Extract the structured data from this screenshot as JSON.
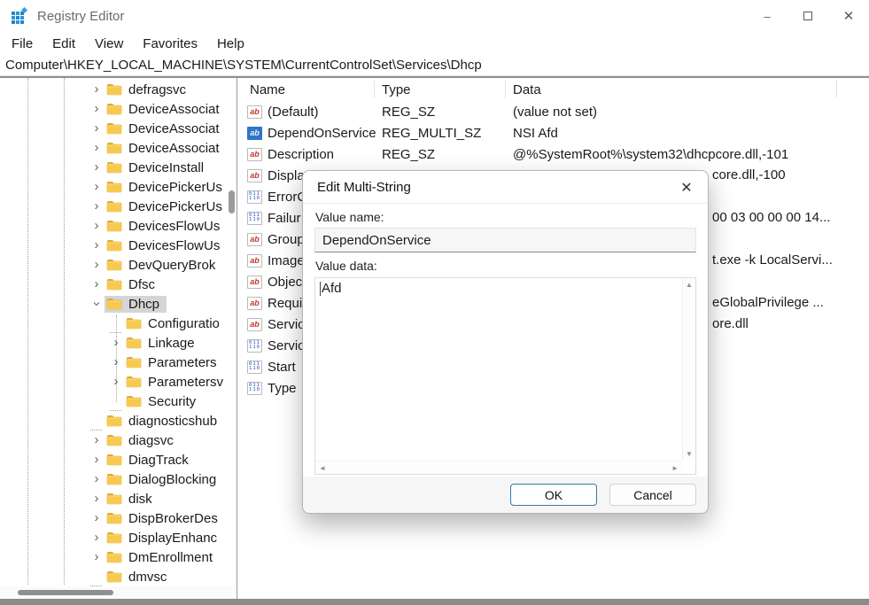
{
  "window": {
    "title": "Registry Editor",
    "controls": {
      "minimize": "–",
      "close": "✕"
    }
  },
  "menu": {
    "items": [
      "File",
      "Edit",
      "View",
      "Favorites",
      "Help"
    ]
  },
  "address": {
    "path": "Computer\\HKEY_LOCAL_MACHINE\\SYSTEM\\CurrentControlSet\\Services\\Dhcp"
  },
  "tree": {
    "items": [
      {
        "label": "defragsvc",
        "level": 0,
        "expander": "collapsed",
        "selected": false
      },
      {
        "label": "DeviceAssociat",
        "level": 0,
        "expander": "collapsed",
        "selected": false
      },
      {
        "label": "DeviceAssociat",
        "level": 0,
        "expander": "collapsed",
        "selected": false
      },
      {
        "label": "DeviceAssociat",
        "level": 0,
        "expander": "collapsed",
        "selected": false
      },
      {
        "label": "DeviceInstall",
        "level": 0,
        "expander": "collapsed",
        "selected": false
      },
      {
        "label": "DevicePickerUs",
        "level": 0,
        "expander": "collapsed",
        "selected": false
      },
      {
        "label": "DevicePickerUs",
        "level": 0,
        "expander": "collapsed",
        "selected": false
      },
      {
        "label": "DevicesFlowUs",
        "level": 0,
        "expander": "collapsed",
        "selected": false
      },
      {
        "label": "DevicesFlowUs",
        "level": 0,
        "expander": "collapsed",
        "selected": false
      },
      {
        "label": "DevQueryBrok",
        "level": 0,
        "expander": "collapsed",
        "selected": false
      },
      {
        "label": "Dfsc",
        "level": 0,
        "expander": "collapsed",
        "selected": false
      },
      {
        "label": "Dhcp",
        "level": 0,
        "expander": "expanded",
        "selected": true
      },
      {
        "label": "Configuratio",
        "level": 1,
        "expander": "none",
        "selected": false
      },
      {
        "label": "Linkage",
        "level": 1,
        "expander": "collapsed",
        "selected": false
      },
      {
        "label": "Parameters",
        "level": 1,
        "expander": "collapsed",
        "selected": false
      },
      {
        "label": "Parametersv",
        "level": 1,
        "expander": "collapsed",
        "selected": false
      },
      {
        "label": "Security",
        "level": 1,
        "expander": "none",
        "selected": false
      },
      {
        "label": "diagnosticshub",
        "level": 0,
        "expander": "none",
        "selected": false
      },
      {
        "label": "diagsvc",
        "level": 0,
        "expander": "collapsed",
        "selected": false
      },
      {
        "label": "DiagTrack",
        "level": 0,
        "expander": "collapsed",
        "selected": false
      },
      {
        "label": "DialogBlocking",
        "level": 0,
        "expander": "collapsed",
        "selected": false
      },
      {
        "label": "disk",
        "level": 0,
        "expander": "collapsed",
        "selected": false
      },
      {
        "label": "DispBrokerDes",
        "level": 0,
        "expander": "collapsed",
        "selected": false
      },
      {
        "label": "DisplayEnhanc",
        "level": 0,
        "expander": "collapsed",
        "selected": false
      },
      {
        "label": "DmEnrollment",
        "level": 0,
        "expander": "collapsed",
        "selected": false
      },
      {
        "label": "dmvsc",
        "level": 0,
        "expander": "none",
        "selected": false
      }
    ]
  },
  "values": {
    "headers": {
      "name": "Name",
      "type": "Type",
      "data": "Data"
    },
    "rows": [
      {
        "icon": "string",
        "selected": false,
        "name": "(Default)",
        "type": "REG_SZ",
        "data": "(value not set)",
        "fragment": ""
      },
      {
        "icon": "string",
        "selected": true,
        "name": "DependOnService",
        "type": "REG_MULTI_SZ",
        "data": "NSI Afd",
        "fragment": ""
      },
      {
        "icon": "string",
        "selected": false,
        "name": "Description",
        "type": "REG_SZ",
        "data": "@%SystemRoot%\\system32\\dhcpcore.dll,-101",
        "fragment": ""
      },
      {
        "icon": "string",
        "selected": false,
        "name": "Displa",
        "type": "",
        "data": "",
        "fragment": "core.dll,-100"
      },
      {
        "icon": "binary",
        "selected": false,
        "name": "ErrorC",
        "type": "",
        "data": "",
        "fragment": ""
      },
      {
        "icon": "binary",
        "selected": false,
        "name": "Failur",
        "type": "",
        "data": "",
        "fragment": "00 03 00 00 00 14..."
      },
      {
        "icon": "string",
        "selected": false,
        "name": "Group",
        "type": "",
        "data": "",
        "fragment": ""
      },
      {
        "icon": "string",
        "selected": false,
        "name": "Image",
        "type": "",
        "data": "",
        "fragment": "t.exe -k LocalServi..."
      },
      {
        "icon": "string",
        "selected": false,
        "name": "Objec",
        "type": "",
        "data": "",
        "fragment": ""
      },
      {
        "icon": "string",
        "selected": false,
        "name": "Requi",
        "type": "",
        "data": "",
        "fragment": "eGlobalPrivilege ..."
      },
      {
        "icon": "string",
        "selected": false,
        "name": "Servic",
        "type": "",
        "data": "",
        "fragment": "ore.dll"
      },
      {
        "icon": "binary",
        "selected": false,
        "name": "Servic",
        "type": "",
        "data": "",
        "fragment": ""
      },
      {
        "icon": "binary",
        "selected": false,
        "name": "Start",
        "type": "",
        "data": "",
        "fragment": ""
      },
      {
        "icon": "binary",
        "selected": false,
        "name": "Type",
        "type": "",
        "data": "",
        "fragment": ""
      }
    ]
  },
  "dialog": {
    "title": "Edit Multi-String",
    "close_glyph": "✕",
    "value_name_label": "Value name:",
    "value_name": "DependOnService",
    "value_data_label": "Value data:",
    "value_data": "Afd",
    "ok_label": "OK",
    "cancel_label": "Cancel"
  },
  "icons": {
    "string_icon_glyph": "ab",
    "binary_icon_line1": "011",
    "binary_icon_line2": "110",
    "collapsed_chevron": "›",
    "scroll_up": "▲",
    "scroll_down": "▼",
    "scroll_left": "◄",
    "scroll_right": "►"
  },
  "colors": {
    "accent": "#1a7ab0",
    "folder_body": "#fcd462",
    "folder_tab": "#e3a83f",
    "selection": "#d5d5d5"
  }
}
